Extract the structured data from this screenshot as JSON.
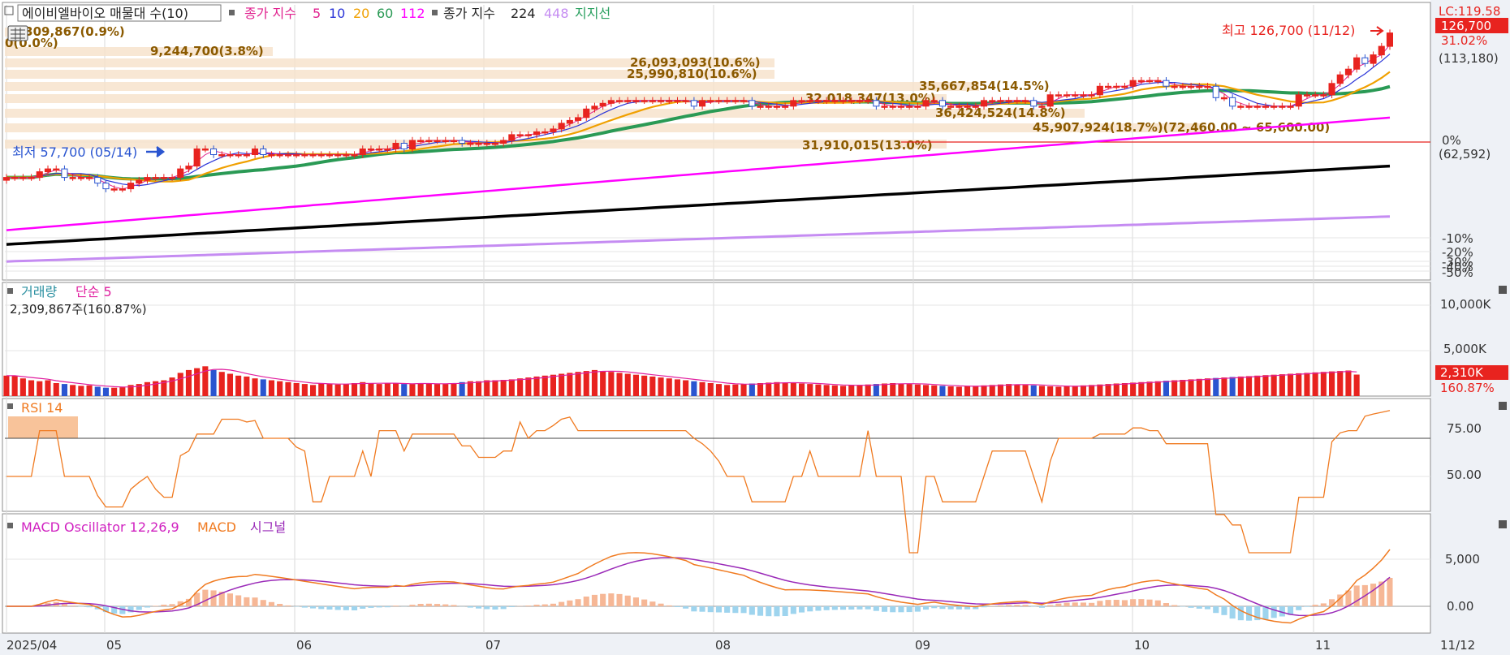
{
  "colors": {
    "up": "#e8231f",
    "down": "#2a55d0",
    "ma5": "#e0208e",
    "ma10": "#2b35d8",
    "ma20": "#f0a000",
    "ma60": "#2a9a55",
    "ma112": "#ff00ff",
    "ma224": "#000000",
    "ma448": "#c58cf2",
    "support": "#2aa060",
    "band": "#f7e3cc",
    "rsi": "#f07a20",
    "macd": "#f07a20",
    "signal": "#9a2ab8",
    "osc_pos": "#f6b796",
    "osc_neg": "#9ed4ee",
    "vol_ma": "#e020a0",
    "annot": "#8b5a00"
  },
  "price_panel": {
    "legend": {
      "title": "에이비엘바이오 매물대 수(10)",
      "ma_label": "종가 지수",
      "ma_periods": [
        "5",
        "10",
        "20",
        "60",
        "112"
      ],
      "ma2_label": "종가 지수",
      "ma2_periods": [
        "224",
        "448"
      ],
      "support_label": "지지선"
    },
    "axis_labels": {
      "lc": "LC:119.58",
      "cur": "126,700",
      "pct": "31.02%",
      "paren_top": "(113,180)",
      "zero": "0%",
      "paren_base": "(62,592)",
      "m10": "-10%",
      "m20": "-20%",
      "m30": "-30%",
      "m40": "-40%",
      "m50": "-50%"
    },
    "high_label": "최고 126,700 (11/12)",
    "low_label": "최저 57,700 (05/14)",
    "vp_labels": [
      "2,309,867(0.9%)",
      "0(0.0%)",
      "9,244,700(3.8%)",
      "26,093,093(10.6%)",
      "25,990,810(10.6%)",
      "32,018,347(13.0%)",
      "35,667,854(14.5%)",
      "36,424,524(14.8%)",
      "45,907,924(18.7%)(72,460.00 ~ 65,600.00)",
      "31,910,015(13.0%)"
    ]
  },
  "volume_panel": {
    "legend": {
      "title": "거래량",
      "ma": "단순 5"
    },
    "info": "2,309,867주(160.87%)",
    "axis_labels": {
      "a": "10,000K",
      "b": "5,000K",
      "cur": "2,310K",
      "pct": "160.87%"
    }
  },
  "rsi_panel": {
    "legend": "RSI 14",
    "axis_labels": {
      "hi": "75.00",
      "mid": "50.00"
    }
  },
  "macd_panel": {
    "legend": {
      "osc": "MACD Oscillator 12,26,9",
      "macd": "MACD",
      "signal": "시그널"
    },
    "axis_labels": {
      "a": "5,000",
      "b": "0.00"
    }
  },
  "x_axis": {
    "labels": [
      "2025/04",
      "05",
      "06",
      "07",
      "08",
      "09",
      "10",
      "11"
    ],
    "end_label": "11/12"
  },
  "chart_data": {
    "type": "candlestick",
    "symbol": "에이비엘바이오",
    "period": "2025/04 ~ 11/12",
    "price": {
      "high": 126700,
      "high_date": "11/12",
      "low": 57700,
      "low_date": "05/14",
      "last": 126700,
      "change_pct": 31.02
    },
    "months": [
      "2025/04",
      "05",
      "06",
      "07",
      "08",
      "09",
      "10",
      "11"
    ],
    "closes": [
      76,
      76,
      76,
      76,
      78,
      79,
      79,
      76,
      76,
      76,
      76,
      74,
      72,
      72,
      72,
      74,
      75,
      76,
      76,
      76,
      76,
      79,
      80,
      86,
      86,
      84,
      84,
      84,
      84,
      84,
      86,
      84,
      84,
      84,
      84,
      84,
      84,
      84,
      84,
      84,
      84,
      84,
      84,
      86,
      86,
      86,
      86,
      88,
      86,
      89,
      89,
      89,
      89,
      89,
      89,
      88,
      88,
      88,
      88,
      88,
      89,
      91,
      91,
      91,
      92,
      92,
      93,
      95,
      96,
      97,
      100,
      101,
      102,
      103,
      103,
      103,
      103,
      103,
      103,
      103,
      103,
      103,
      103,
      101,
      103,
      103,
      103,
      103,
      103,
      103,
      101,
      101,
      101,
      101,
      101,
      103,
      103,
      103,
      103,
      103,
      103,
      103,
      103,
      103,
      103,
      101,
      101,
      101,
      101,
      101,
      101,
      103,
      103,
      101,
      101,
      101,
      101,
      101,
      103,
      103,
      103,
      103,
      103,
      103,
      101,
      101,
      105,
      105,
      105,
      105,
      105,
      105,
      108,
      108,
      108,
      108,
      110,
      110,
      110,
      110,
      108,
      108,
      108,
      108,
      108,
      108,
      104,
      104,
      101,
      101,
      101,
      101,
      101,
      101,
      101,
      101,
      105,
      105,
      105,
      105,
      109,
      112,
      114,
      118,
      116,
      119,
      122,
      126.7
    ],
    "volume_k": [
      2200,
      2180,
      1900,
      1700,
      1600,
      1700,
      1400,
      1300,
      1200,
      1100,
      1150,
      1000,
      900,
      900,
      950,
      1200,
      1300,
      1500,
      1600,
      1700,
      2000,
      2500,
      2800,
      3000,
      3200,
      2800,
      2600,
      2400,
      2200,
      2100,
      1900,
      1800,
      1700,
      1600,
      1500,
      1400,
      1300,
      1200,
      1400,
      1300,
      1250,
      1300,
      1400,
      1500,
      1400,
      1300,
      1350,
      1400,
      1300,
      1300,
      1400,
      1350,
      1300,
      1300,
      1400,
      1500,
      1600,
      1600,
      1700,
      1700,
      1750,
      1800,
      1900,
      2000,
      2100,
      2200,
      2300,
      2400,
      2500,
      2600,
      2700,
      2800,
      2700,
      2600,
      2500,
      2400,
      2300,
      2200,
      2100,
      2000,
      1900,
      1800,
      1700,
      1600,
      1500,
      1400,
      1300,
      1200,
      1250,
      1300,
      1350,
      1400,
      1450,
      1500,
      1450,
      1400,
      1350,
      1300,
      1250,
      1200,
      1150,
      1100,
      1150,
      1200,
      1250,
      1300,
      1350,
      1400,
      1350,
      1300,
      1250,
      1200,
      1150,
      1100,
      1050,
      1000,
      1050,
      1100,
      1150,
      1200,
      1250,
      1300,
      1250,
      1200,
      1150,
      1100,
      1050,
      1000,
      1050,
      1100,
      1150,
      1200,
      1250,
      1300,
      1350,
      1400,
      1450,
      1500,
      1550,
      1600,
      1650,
      1700,
      1750,
      1800,
      1850,
      1900,
      1950,
      2000,
      2050,
      2100,
      2150,
      2200,
      2250,
      2300,
      2350,
      2400,
      2450,
      2500,
      2550,
      2600,
      2650,
      2700,
      2750,
      2310
    ],
    "rsi": {
      "period": 14,
      "levels": [
        75,
        50
      ],
      "last": 72
    },
    "macd": {
      "fast": 12,
      "slow": 26,
      "signal": 9
    }
  }
}
